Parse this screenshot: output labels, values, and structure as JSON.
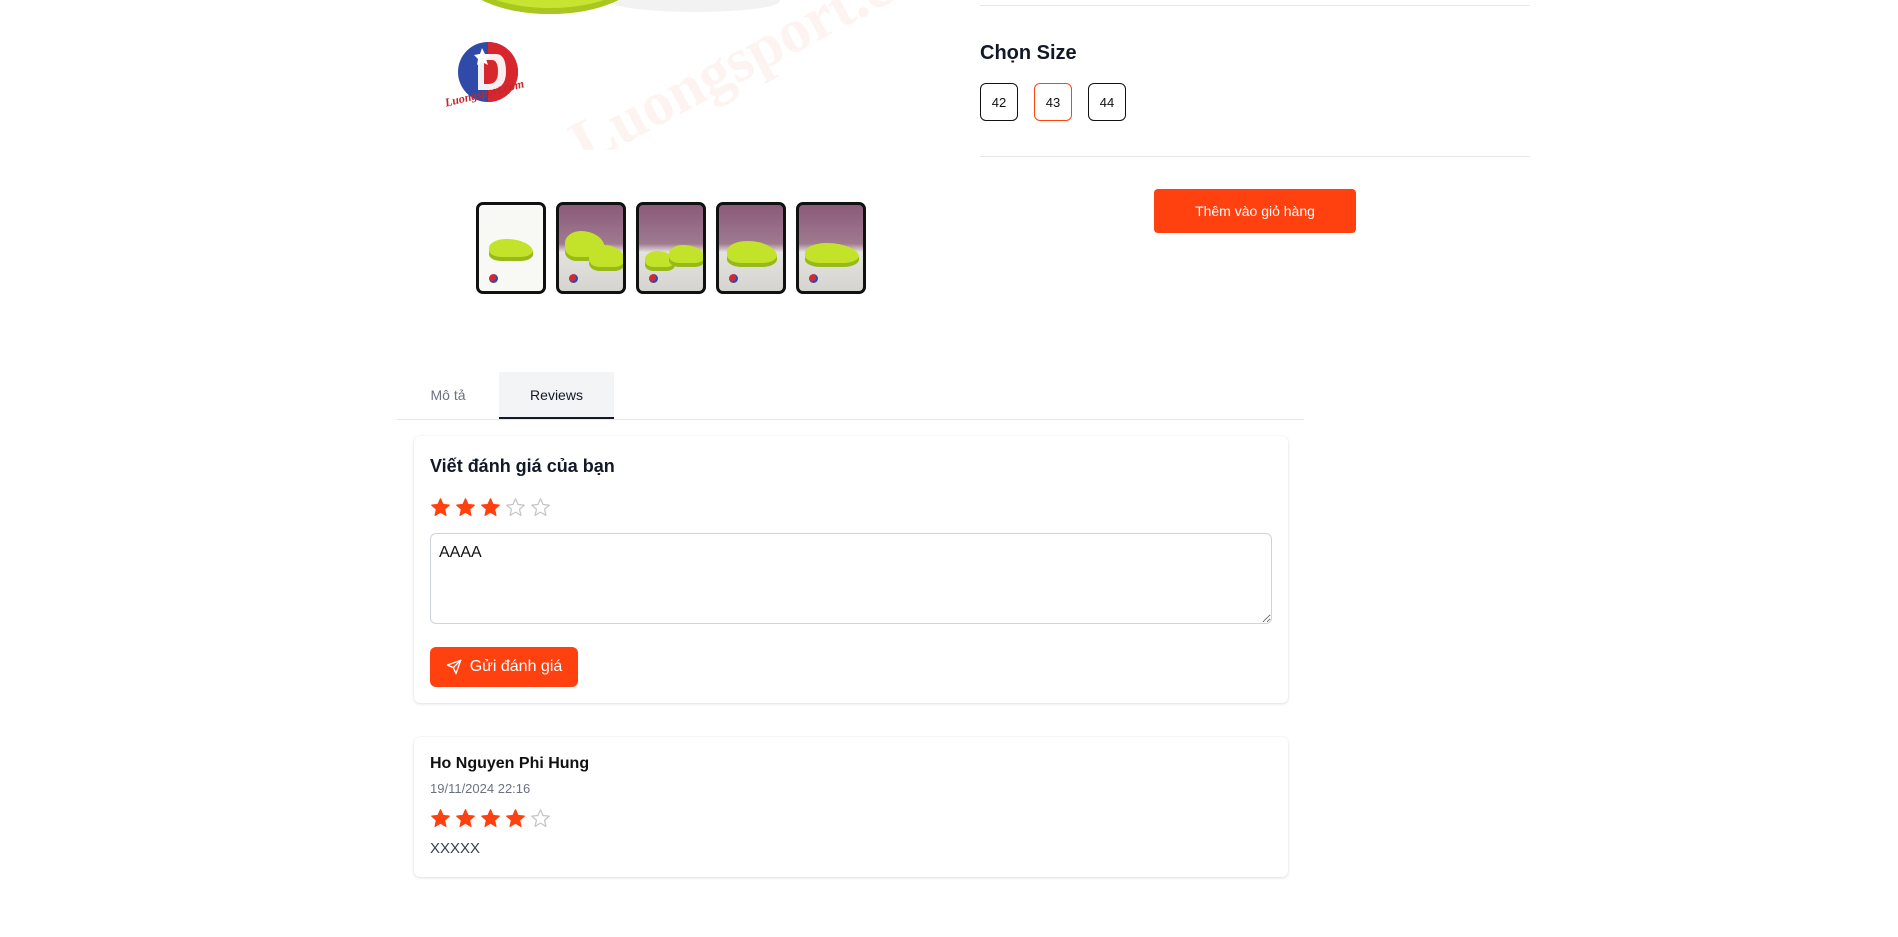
{
  "product_gallery": {
    "watermark_text": "Luongsport.com",
    "logo_text": "Luongsport.com",
    "thumbnails": [
      {
        "alt": "shoe-side-white"
      },
      {
        "alt": "shoe-pair-purple"
      },
      {
        "alt": "shoe-pair-purple-2"
      },
      {
        "alt": "shoe-top-purple"
      },
      {
        "alt": "shoe-side-purple"
      }
    ]
  },
  "size_selector": {
    "title": "Chọn Size",
    "options": [
      "42",
      "43",
      "44"
    ],
    "selected": "43"
  },
  "cart": {
    "add_label": "Thêm vào giỏ hàng"
  },
  "tabs": [
    {
      "label": "Mô tả",
      "active": false
    },
    {
      "label": "Reviews",
      "active": true
    }
  ],
  "review_form": {
    "title": "Viết đánh giá của bạn",
    "rating": 3,
    "max_rating": 5,
    "textarea_value": "AAAA",
    "submit_label": "Gửi đánh giá"
  },
  "reviews": [
    {
      "author": "Ho Nguyen Phi Hung",
      "date": "19/11/2024 22:16",
      "rating": 4,
      "max_rating": 5,
      "text": "XXXXX"
    }
  ],
  "colors": {
    "accent": "#ff400f",
    "star_filled": "#ff400f",
    "star_empty": "#c4c4c4"
  }
}
